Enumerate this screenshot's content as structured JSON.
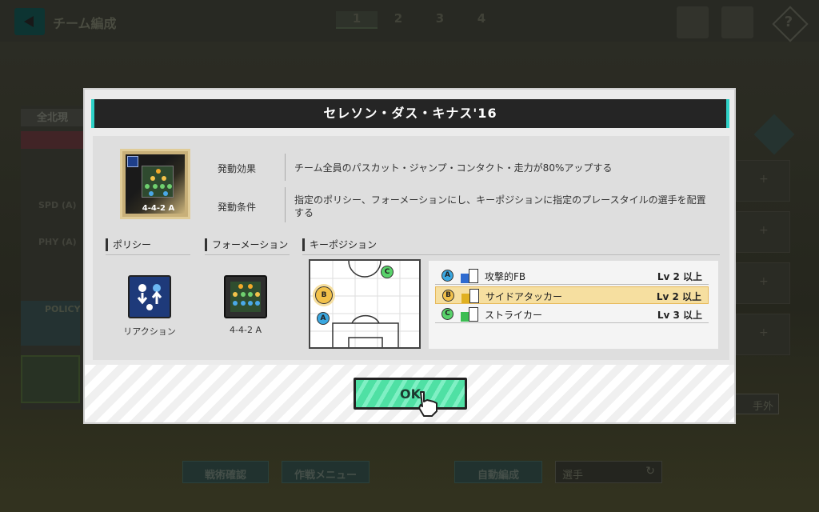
{
  "background": {
    "title": "チーム編成",
    "pages": [
      "1",
      "2",
      "3",
      "4"
    ],
    "left_panel_header": "全北現",
    "stats": [
      "SPD (A)",
      "PHY (A)"
    ],
    "policy_label": "POLICY",
    "exclude_button": "手外",
    "bottom_buttons": [
      "戦術確認",
      "作戦メニュー",
      "自動編成"
    ],
    "select_value": "選手"
  },
  "dialog": {
    "title": "セレソン・ダス・キナス'16",
    "card_label": "4-4-2 A",
    "effect_label": "発動効果",
    "effect_value": "チーム全員のパスカット・ジャンプ・コンタクト・走力が80%アップする",
    "condition_label": "発動条件",
    "condition_value": "指定のポリシー、フォーメーションにし、キーポジションに指定のプレースタイルの選手を配置する",
    "policy_section": "ポリシー",
    "policy_name": "リアクション",
    "formation_section": "フォーメーション",
    "formation_name": "4-4-2 A",
    "keypos_section": "キーポジション",
    "field_markers": {
      "a": "A",
      "b": "B",
      "c": "C"
    },
    "positions": [
      {
        "mark": "A",
        "name": "攻撃的FB",
        "level": "Lv 2 以上",
        "highlight": false,
        "color": "#3aa7e0",
        "tag_color": "#2f6bd0"
      },
      {
        "mark": "B",
        "name": "サイドアタッカー",
        "level": "Lv 2 以上",
        "highlight": true,
        "color": "#f2c14a",
        "tag_color": "#e0b020"
      },
      {
        "mark": "C",
        "name": "ストライカー",
        "level": "Lv 3 以上",
        "highlight": false,
        "color": "#58d26a",
        "tag_color": "#3bbd52"
      }
    ],
    "ok_label": "OK"
  },
  "colors": {
    "accent": "#2ed2c8",
    "ok_green": "#4fe0a4",
    "highlight": "#f6dfa0"
  },
  "icons": [
    "back-icon",
    "help-icon",
    "hand-pointer-icon",
    "policy-reaction-icon",
    "formation-icon"
  ]
}
